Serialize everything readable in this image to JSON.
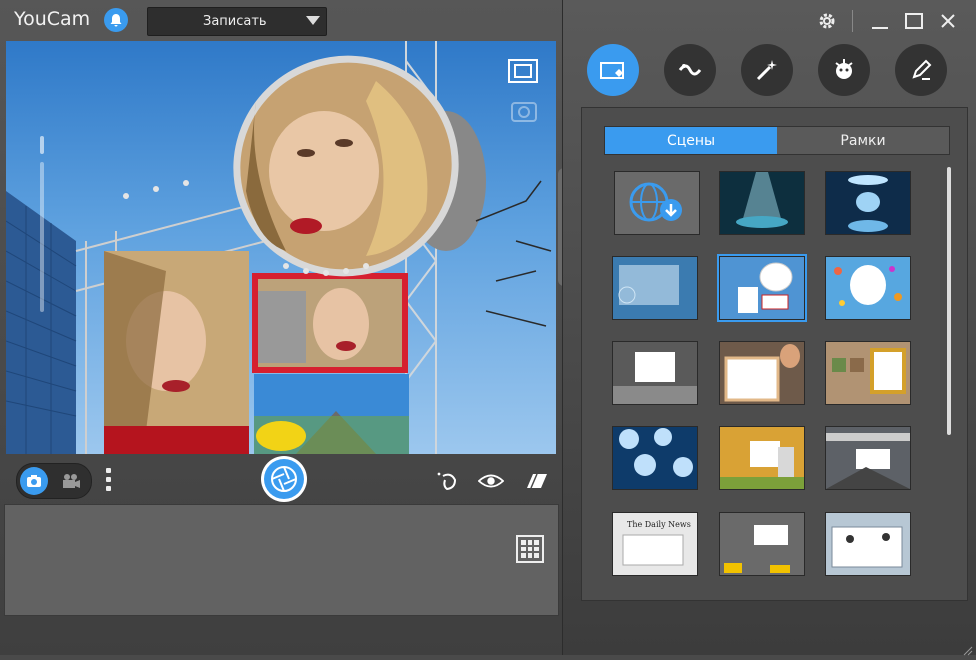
{
  "app": {
    "title": "YouCam"
  },
  "recorder": {
    "selected": "Записать"
  },
  "effects_tabs": [
    {
      "name": "scenes-tab",
      "icon": "scene-icon",
      "active": true
    },
    {
      "name": "avatar-tab",
      "icon": "avatar-icon",
      "active": false
    },
    {
      "name": "magic-tab",
      "icon": "magic-wand-icon",
      "active": false
    },
    {
      "name": "gadgets-tab",
      "icon": "gadget-icon",
      "active": false
    },
    {
      "name": "draw-tab",
      "icon": "pen-icon",
      "active": false
    }
  ],
  "subtabs": {
    "scenes": "Сцены",
    "frames": "Рамки"
  },
  "colors": {
    "accent": "#3a9bef",
    "panel": "#4d4d4d",
    "dark": "#333333"
  },
  "thumbnails": [
    {
      "name": "download-more",
      "bg": "#6a6a6a",
      "selected": false
    },
    {
      "name": "spotlight-stage",
      "bg": "#0d2f3e",
      "selected": false
    },
    {
      "name": "blue-room",
      "bg": "#1a5788",
      "selected": false
    },
    {
      "name": "tech-screen",
      "bg": "#3b7bb0",
      "selected": false
    },
    {
      "name": "billboards",
      "bg": "#4f94d3",
      "selected": true
    },
    {
      "name": "balloons",
      "bg": "#57a7e0",
      "selected": false
    },
    {
      "name": "gallery-bw",
      "bg": "#9a9a9a",
      "selected": false
    },
    {
      "name": "hold-frame",
      "bg": "#6e5a4a",
      "selected": false
    },
    {
      "name": "art-gallery",
      "bg": "#b19373",
      "selected": false
    },
    {
      "name": "bubbles",
      "bg": "#3f8fd6",
      "selected": false
    },
    {
      "name": "autumn-park",
      "bg": "#c79a3a",
      "selected": false
    },
    {
      "name": "train-station",
      "bg": "#7a7e84",
      "selected": false
    },
    {
      "name": "newspaper",
      "bg": "#d9d9d9",
      "selected": false
    },
    {
      "name": "times-square",
      "bg": "#8f8f8f",
      "selected": false
    },
    {
      "name": "window-cleaners",
      "bg": "#8fa4b6",
      "selected": false
    }
  ],
  "newspaper_text": "The Daily News"
}
